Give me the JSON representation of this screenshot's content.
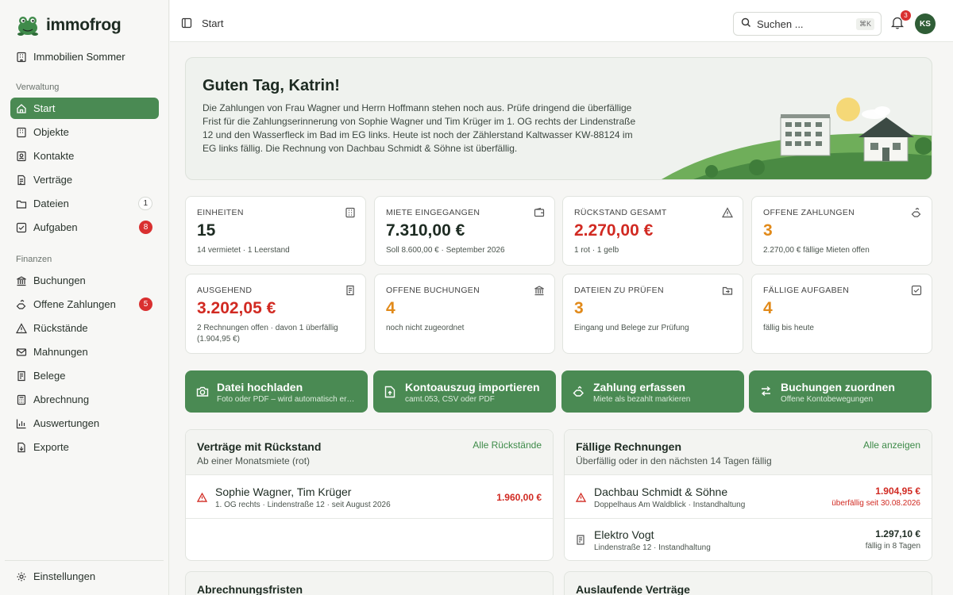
{
  "app": {
    "name": "immofrog",
    "portfolio": "Immobilien Sommer"
  },
  "sidebar": {
    "sections": {
      "verwaltung": "Verwaltung",
      "finanzen": "Finanzen"
    },
    "verwaltung_items": [
      {
        "label": "Start",
        "icon": "home-icon",
        "active": true
      },
      {
        "label": "Objekte",
        "icon": "building-icon"
      },
      {
        "label": "Kontakte",
        "icon": "contacts-icon"
      },
      {
        "label": "Verträge",
        "icon": "contract-icon"
      },
      {
        "label": "Dateien",
        "icon": "folder-icon",
        "badge": "1"
      },
      {
        "label": "Aufgaben",
        "icon": "checkbox-icon",
        "badge": "8"
      }
    ],
    "finanzen_items": [
      {
        "label": "Buchungen",
        "icon": "bank-icon"
      },
      {
        "label": "Offene Zahlungen",
        "icon": "payment-icon",
        "badge": "5"
      },
      {
        "label": "Rückstände",
        "icon": "warning-icon"
      },
      {
        "label": "Mahnungen",
        "icon": "mail-icon"
      },
      {
        "label": "Belege",
        "icon": "receipt-icon"
      },
      {
        "label": "Abrechnung",
        "icon": "calculator-icon"
      },
      {
        "label": "Auswertungen",
        "icon": "chart-icon"
      },
      {
        "label": "Exporte",
        "icon": "export-icon"
      }
    ],
    "settings": "Einstellungen"
  },
  "header": {
    "breadcrumb": "Start",
    "search_placeholder": "Suchen ...",
    "search_shortcut": "⌘K",
    "notification_count": "3",
    "avatar_initials": "KS"
  },
  "hero": {
    "title": "Guten Tag, Katrin!",
    "text": "Die Zahlungen von Frau Wagner und Herrn Hoffmann stehen noch aus. Prüfe dringend die überfällige Frist für die Zahlungserinnerung von Sophie Wagner und Tim Krüger im 1. OG rechts der Lindenstraße 12 und den Wasserfleck im Bad im EG links. Heute ist noch der Zählerstand Kaltwasser KW-88124 im EG links fällig. Die Rechnung von Dachbau Schmidt & Söhne ist überfällig."
  },
  "cards": [
    {
      "label": "EINHEITEN",
      "value": "15",
      "sub": "14 vermietet · 1 Leerstand",
      "tone": "normal",
      "icon": "building-icon"
    },
    {
      "label": "MIETE EINGEGANGEN",
      "value": "7.310,00 €",
      "sub": "Soll 8.600,00 € · September 2026",
      "tone": "normal",
      "icon": "wallet-icon"
    },
    {
      "label": "RÜCKSTAND GESAMT",
      "value": "2.270,00 €",
      "sub": "1 rot · 1 gelb",
      "tone": "red",
      "icon": "warning-icon"
    },
    {
      "label": "OFFENE ZAHLUNGEN",
      "value": "3",
      "sub": "2.270,00 € fällige Mieten offen",
      "tone": "orange",
      "icon": "payment-icon"
    },
    {
      "label": "AUSGEHEND",
      "value": "3.202,05 €",
      "sub": "2 Rechnungen offen · davon 1 überfällig (1.904,95 €)",
      "tone": "red",
      "icon": "receipt-icon"
    },
    {
      "label": "OFFENE BUCHUNGEN",
      "value": "4",
      "sub": "noch nicht zugeordnet",
      "tone": "orange",
      "icon": "bank-icon"
    },
    {
      "label": "DATEIEN ZU PRÜFEN",
      "value": "3",
      "sub": "Eingang und Belege zur Prüfung",
      "tone": "orange",
      "icon": "folder-icon"
    },
    {
      "label": "FÄLLIGE AUFGABEN",
      "value": "4",
      "sub": "fällig bis heute",
      "tone": "orange",
      "icon": "checkbox-icon"
    }
  ],
  "actions": [
    {
      "title": "Datei hochladen",
      "sub": "Foto oder PDF – wird automatisch erkannt",
      "icon": "camera-icon"
    },
    {
      "title": "Kontoauszug importieren",
      "sub": "camt.053, CSV oder PDF",
      "icon": "file-upload-icon"
    },
    {
      "title": "Zahlung erfassen",
      "sub": "Miete als bezahlt markieren",
      "icon": "payment-icon"
    },
    {
      "title": "Buchungen zuordnen",
      "sub": "Offene Kontobewegungen",
      "icon": "swap-icon"
    }
  ],
  "panels": {
    "rueckstand": {
      "title": "Verträge mit Rückstand",
      "sub": "Ab einer Monatsmiete (rot)",
      "link": "Alle Rückstände",
      "rows": [
        {
          "title": "Sophie Wagner, Tim Krüger",
          "sub": "1. OG rechts · Lindenstraße 12 · seit August 2026",
          "amount": "1.960,00 €",
          "tone": "red"
        }
      ]
    },
    "rechnungen": {
      "title": "Fällige Rechnungen",
      "sub": "Überfällig oder in den nächsten 14 Tagen fällig",
      "link": "Alle anzeigen",
      "rows": [
        {
          "title": "Dachbau Schmidt & Söhne",
          "sub": "Doppelhaus Am Waldblick · Instandhaltung",
          "amount": "1.904,95 €",
          "note": "überfällig seit 30.08.2026",
          "tone": "red"
        },
        {
          "title": "Elektro Vogt",
          "sub": "Lindenstraße 12 · Instandhaltung",
          "amount": "1.297,10 €",
          "note": "fällig in 8 Tagen",
          "tone": "normal"
        }
      ]
    },
    "fristen": {
      "title": "Abrechnungsfristen"
    },
    "auslaufend": {
      "title": "Auslaufende Verträge"
    }
  },
  "colors": {
    "brand": "#4a8a53",
    "danger": "#d12a22",
    "warning": "#e18a1a"
  }
}
